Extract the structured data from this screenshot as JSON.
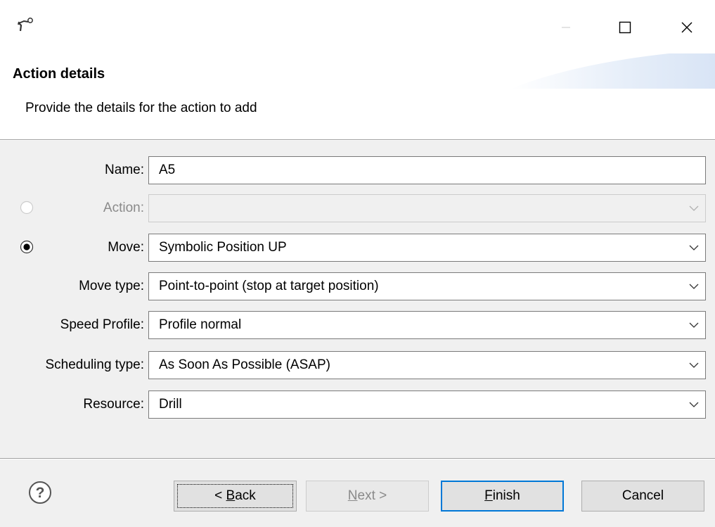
{
  "header": {
    "title": "Action details",
    "description": "Provide the details for the action to add"
  },
  "form": {
    "name": {
      "label": "Name:",
      "value": "A5"
    },
    "action": {
      "label": "Action:",
      "value": "",
      "enabled": false,
      "radio_selected": false
    },
    "move": {
      "label": "Move:",
      "value": "Symbolic Position UP",
      "radio_selected": true
    },
    "move_type": {
      "label": "Move type:",
      "value": "Point-to-point (stop at target position)"
    },
    "speed_profile": {
      "label": "Speed Profile:",
      "value": "Profile normal"
    },
    "scheduling_type": {
      "label": "Scheduling type:",
      "value": "As Soon As Possible (ASAP)"
    },
    "resource": {
      "label": "Resource:",
      "value": "Drill"
    }
  },
  "buttons": {
    "back": {
      "mnemonic": "B",
      "rest": "ack",
      "prefix": "< "
    },
    "next": {
      "mnemonic": "N",
      "rest": "ext >"
    },
    "finish": {
      "mnemonic": "F",
      "rest": "inish"
    },
    "cancel": "Cancel"
  },
  "icons": {
    "app": "robot-arm-icon",
    "help": "help-icon",
    "minimize": "minimize-icon",
    "maximize": "maximize-icon",
    "close": "close-icon",
    "dropdown": "chevron-down-icon"
  },
  "colors": {
    "accent": "#0078d7",
    "disabled_text": "#8a8a8a",
    "window_bg": "#f0f0f0"
  }
}
